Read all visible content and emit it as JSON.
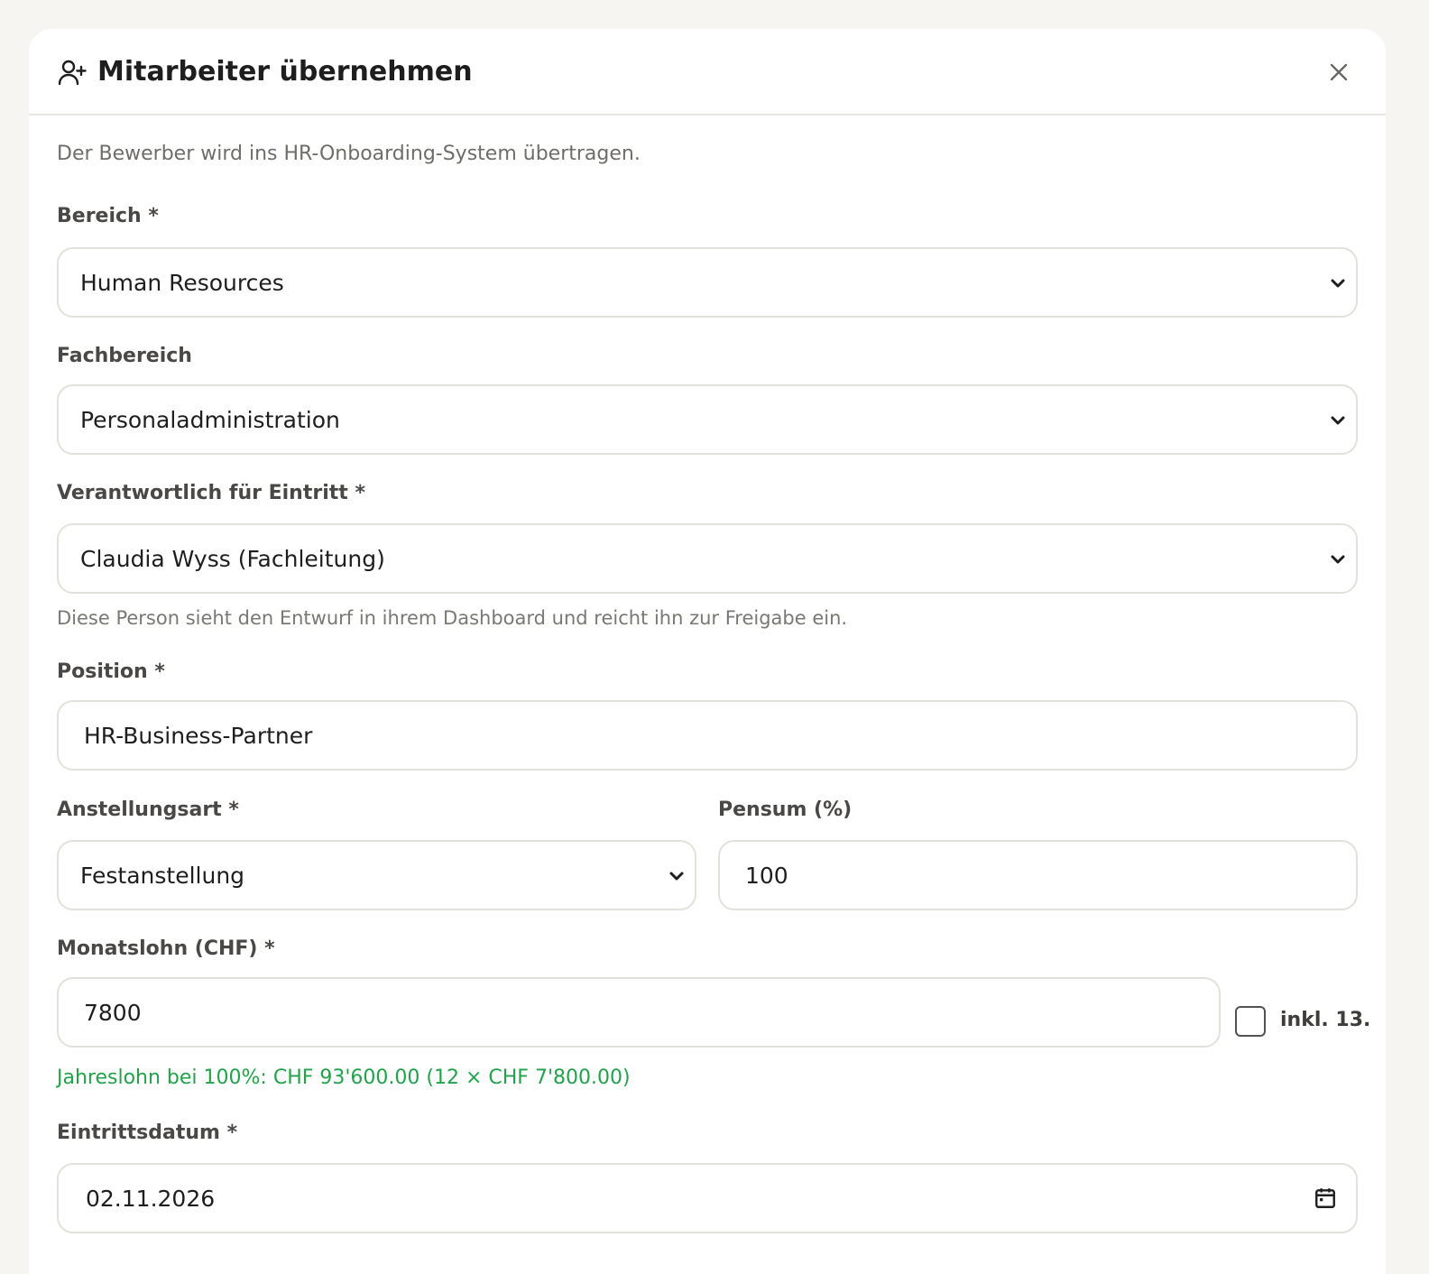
{
  "modal": {
    "title": "Mitarbeiter übernehmen",
    "header_icon": "user-plus-icon",
    "close_icon": "close-icon"
  },
  "intro": "Der Bewerber wird ins HR-Onboarding-System übertragen.",
  "fields": {
    "bereich": {
      "label": "Bereich *",
      "value": "Human Resources"
    },
    "fachbereich": {
      "label": "Fachbereich",
      "value": "Personaladministration"
    },
    "verantwortlich": {
      "label": "Verantwortlich für Eintritt *",
      "value": "Claudia Wyss (Fachleitung)",
      "hint": "Diese Person sieht den Entwurf in ihrem Dashboard und reicht ihn zur Freigabe ein."
    },
    "position": {
      "label": "Position *",
      "value": "HR-Business-Partner"
    },
    "anstellungsart": {
      "label": "Anstellungsart *",
      "value": "Festanstellung"
    },
    "pensum": {
      "label": "Pensum (%)",
      "value": "100"
    },
    "monatslohn": {
      "label": "Monatslohn (CHF) *",
      "value": "7800",
      "checkbox_label": "inkl. 13.",
      "checkbox_checked": false,
      "summary": "Jahreslohn bei 100%: CHF 93'600.00 (12 × CHF 7'800.00)"
    },
    "eintrittsdatum": {
      "label": "Eintrittsdatum *",
      "value": "02.11.2026",
      "icon": "calendar-icon"
    }
  },
  "colors": {
    "success": "#22a24a",
    "border": "#e3e1dc",
    "background": "#f6f5f1"
  }
}
